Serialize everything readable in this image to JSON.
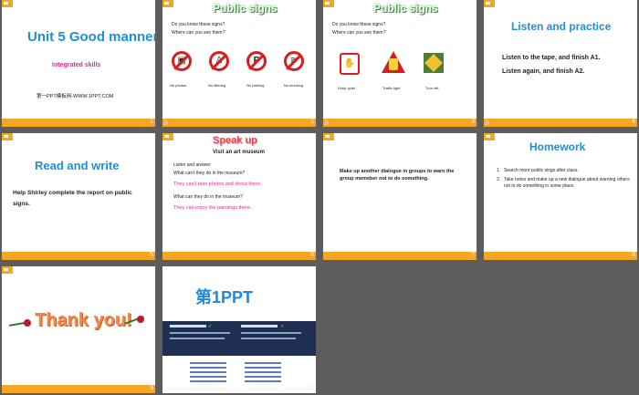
{
  "slides": [
    {
      "num": "1",
      "title": "Unit 5 Good manners",
      "subtitle": "Integrated skills",
      "footer": "第一PPT模板网-WWW.1PPT.COM"
    },
    {
      "num": "2",
      "header": "Public signs",
      "q1": "Do you know these signs?",
      "q2": "Where can you see them?",
      "labels": [
        "No photos",
        "No littering",
        "No parking",
        "No smoking"
      ]
    },
    {
      "num": "3",
      "header": "Public signs",
      "q1": "Do you know these signs?",
      "q2": "Where can you see them?",
      "labels": [
        "Keep quiet",
        "Traffic light",
        "Turn left"
      ]
    },
    {
      "num": "4",
      "title": "Listen and practice",
      "line1": "Listen to the tape, and finish A1.",
      "line2": "Listen again, and finish A2."
    },
    {
      "num": "5",
      "title": "Read and write",
      "body": "Help Shirley complete the report on public signs."
    },
    {
      "num": "6",
      "header": "Speak up",
      "sub": "Visit an art museum",
      "l1": "Listen and answer",
      "q1": "What can't they do in the museum?",
      "a1": "They can't take photos and shout there.",
      "q2": "What can they do in the museum?",
      "a2": "They can enjoy the paintings there."
    },
    {
      "num": "7",
      "body": "Make up another dialogue in groups to warn the group memeber not to do something."
    },
    {
      "num": "8",
      "title": "Homework",
      "items": [
        "Search more public sings after class.",
        "Take notes and make up a new dialogue about warning others not to do something in some place."
      ]
    },
    {
      "num": "9",
      "title": "Thank you!"
    },
    {
      "num": "10",
      "logo": "第1PPT"
    }
  ],
  "icons": {
    "star": "star-icon"
  }
}
